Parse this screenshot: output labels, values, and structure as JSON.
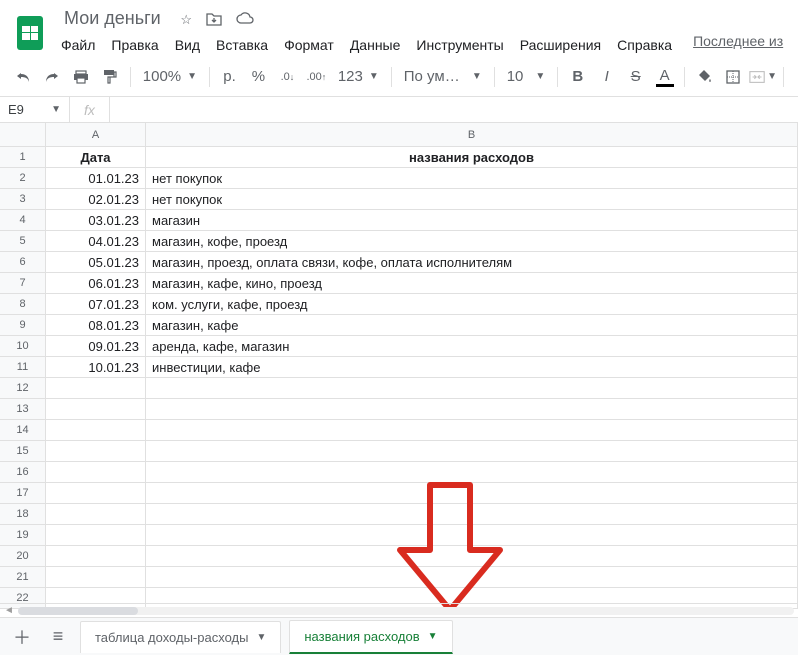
{
  "header": {
    "doc_title": "Мои деньги",
    "last_edit": "Последнее из",
    "menu": [
      "Файл",
      "Правка",
      "Вид",
      "Вставка",
      "Формат",
      "Данные",
      "Инструменты",
      "Расширения",
      "Справка"
    ]
  },
  "toolbar": {
    "zoom": "100%",
    "currency": "р.",
    "percent": "%",
    "dec_dec": ".0",
    "inc_dec": ".00",
    "more_fmt": "123",
    "font": "По умолча...",
    "font_size": "10",
    "bold": "B",
    "italic": "I",
    "strike": "S",
    "text_color": "A"
  },
  "namebox": {
    "cell": "E9",
    "fx": "fx"
  },
  "columns": {
    "a": "A",
    "b": "B"
  },
  "table": {
    "headers": {
      "a": "Дата",
      "b": "названия расходов"
    },
    "rows": [
      {
        "n": "2",
        "a": "01.01.23",
        "b": "нет покупок"
      },
      {
        "n": "3",
        "a": "02.01.23",
        "b": "нет покупок"
      },
      {
        "n": "4",
        "a": "03.01.23",
        "b": "магазин"
      },
      {
        "n": "5",
        "a": "04.01.23",
        "b": "магазин, кофе, проезд"
      },
      {
        "n": "6",
        "a": "05.01.23",
        "b": "магазин, проезд, оплата связи, кофе, оплата исполнителям"
      },
      {
        "n": "7",
        "a": "06.01.23",
        "b": "магазин, кафе, кино, проезд"
      },
      {
        "n": "8",
        "a": "07.01.23",
        "b": "ком. услуги, кафе, проезд"
      },
      {
        "n": "9",
        "a": "08.01.23",
        "b": "магазин, кафе"
      },
      {
        "n": "10",
        "a": "09.01.23",
        "b": "аренда, кафе, магазин"
      },
      {
        "n": "11",
        "a": "10.01.23",
        "b": "инвестиции, кафе"
      }
    ],
    "empty_rows": [
      "12",
      "13",
      "14",
      "15",
      "16",
      "17",
      "18",
      "19",
      "20",
      "21",
      "22"
    ]
  },
  "sheets": {
    "tab1": "таблица доходы-расходы",
    "tab2": "названия расходов"
  }
}
